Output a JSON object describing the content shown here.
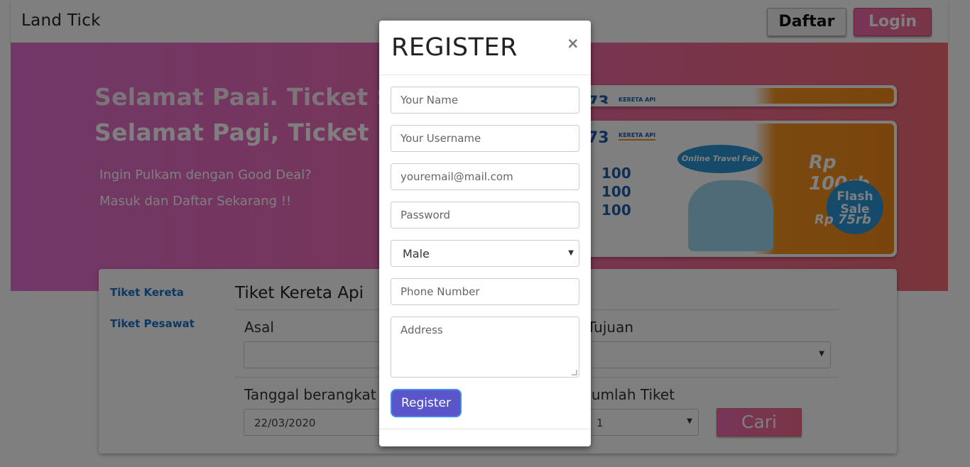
{
  "navbar": {
    "brand": "Land Tick",
    "daftar_label": "Daftar",
    "login_label": "Login"
  },
  "hero": {
    "title_back": "Selamat Paai. Ticket Se",
    "title": "Selamat Pagi, Ticket Se",
    "subtitle_1": "Ingin Pulkam dengan Good Deal?",
    "subtitle_2": "Masuk dan Daftar Sekarang !!"
  },
  "banner": {
    "logo": "73",
    "kai": "KERETA API",
    "fair": "Online Travel Fair",
    "price_1": "100",
    "price_2": "100",
    "price_3": "100",
    "right_price": "Rp 100rb",
    "flash": "Flash Sale",
    "rp75": "Rp 75rb"
  },
  "search": {
    "tabs": [
      "Tiket Kereta",
      "Tiket Pesawat"
    ],
    "title": "Tiket Kereta Api",
    "asal_label": "Asal",
    "tujuan_label": "Tujuan",
    "tanggal_label": "Tanggal berangkat",
    "tanggal_value": "22/03/2020",
    "jumlah_label": "Jumlah Tiket",
    "jumlah_value": "1",
    "cari_label": "Cari"
  },
  "modal": {
    "title": "REGISTER",
    "close": "×",
    "name_placeholder": "Your Name",
    "username_placeholder": "Your Username",
    "email_placeholder": "youremail@mail.com",
    "password_placeholder": "Password",
    "gender_value": "Male",
    "phone_placeholder": "Phone Number",
    "address_placeholder": "Address",
    "register_label": "Register"
  }
}
